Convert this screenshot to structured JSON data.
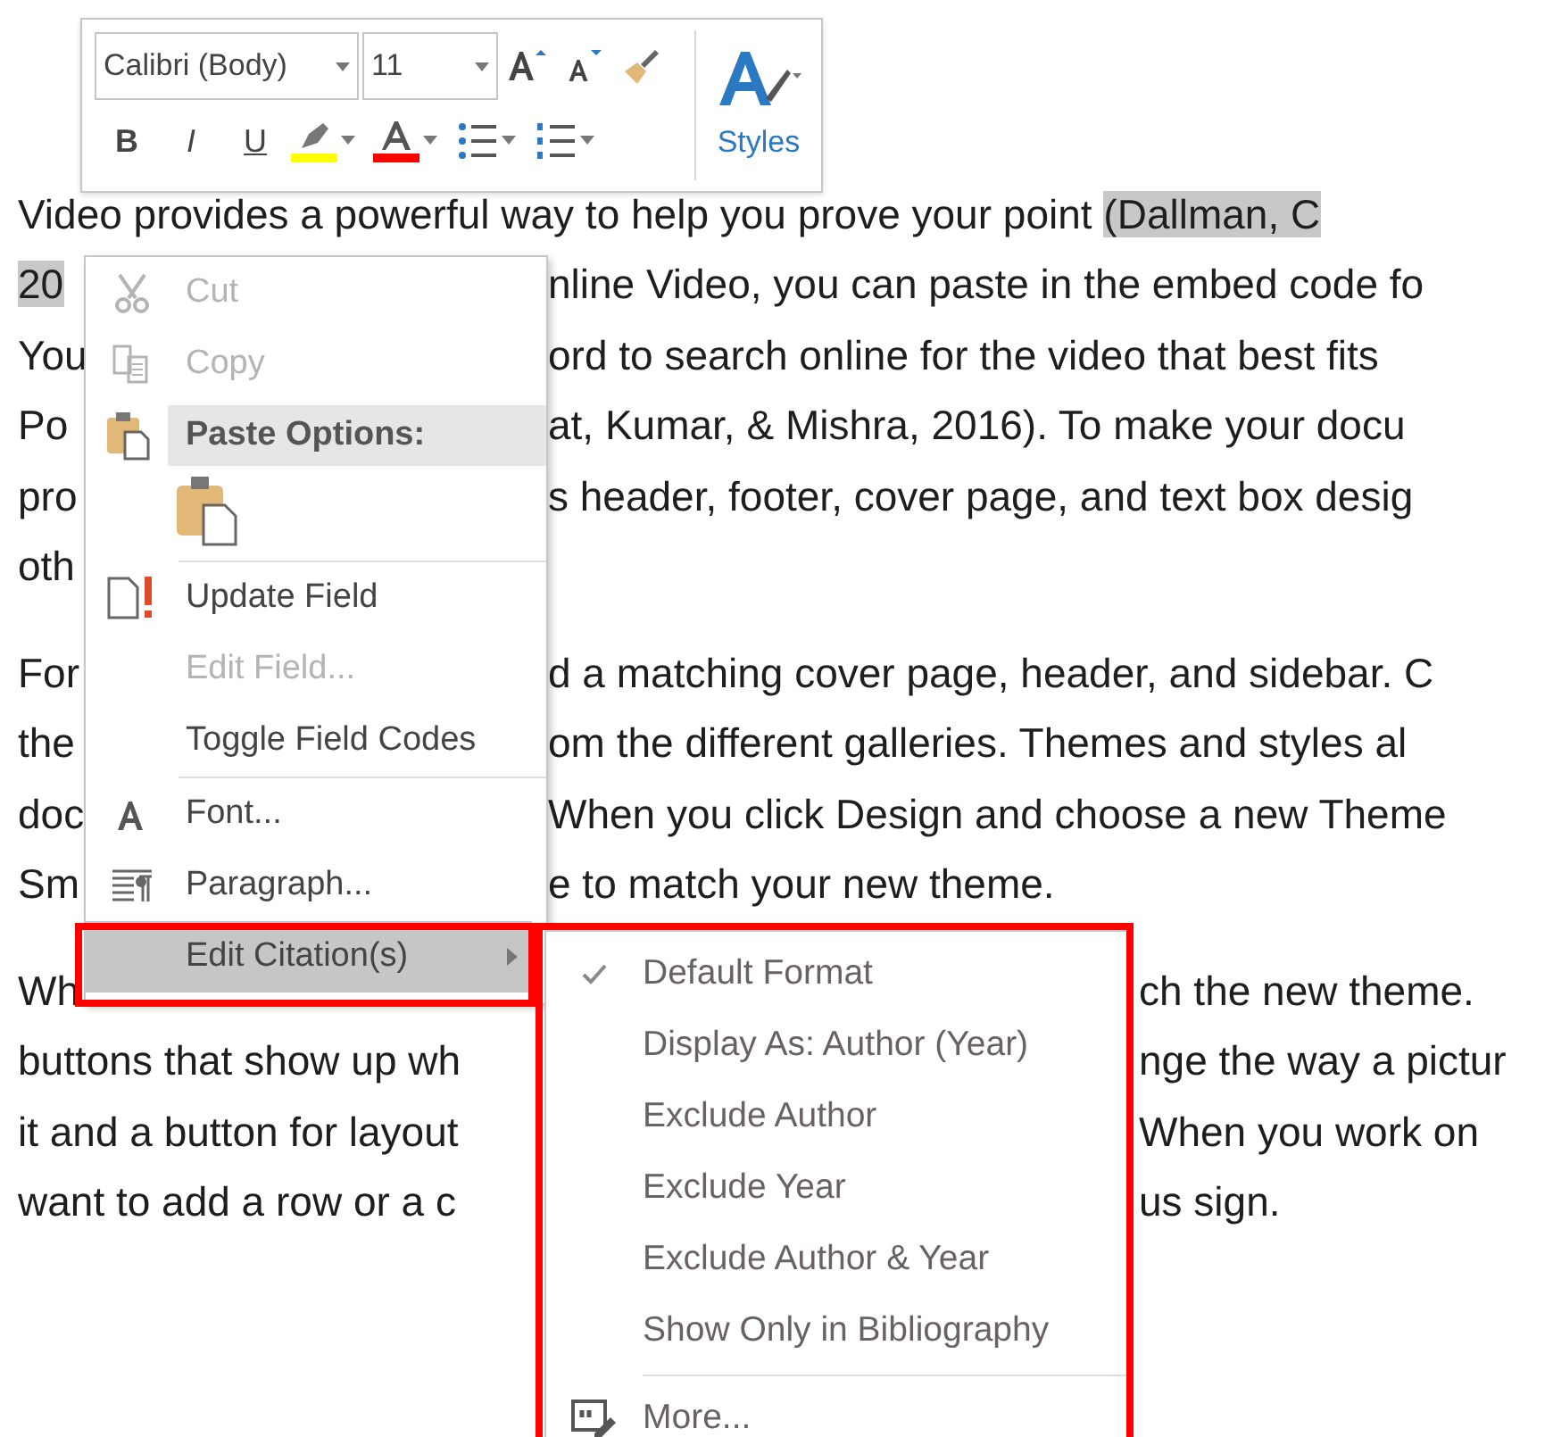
{
  "document": {
    "paragraphs": [
      {
        "lines": [
          {
            "left": "Video provides a powerful way to help you prove your point ",
            "left_selected": "(Dallman, C"
          },
          {
            "left_selected": "20",
            "right": "nline Video, you can paste in the embed code fo"
          },
          {
            "left": "You",
            "right": "ord to search online for the video that best fits"
          },
          {
            "left": "Po",
            "right": "at, Kumar, & Mishra, 2016). To make your docu"
          },
          {
            "left": "pro",
            "right": "s header, footer, cover page, and text box desig"
          },
          {
            "left": "oth"
          }
        ]
      },
      {
        "lines": [
          {
            "left": "For",
            "right": "d a matching cover page, header, and sidebar. C"
          },
          {
            "left": "the",
            "right": "om the different galleries. Themes and styles al"
          },
          {
            "left": "doc",
            "right": "When you click Design and choose a new Theme"
          },
          {
            "left": "Sm",
            "right": "e to match your new theme."
          }
        ]
      },
      {
        "lines": [
          {
            "left": "Wh",
            "right": "ch the new theme."
          },
          {
            "left": "buttons that show up wh",
            "right": "nge the way a pictur"
          },
          {
            "left": "it and a button for layout",
            "right": "When you work on"
          },
          {
            "left": "want to add a row or a c",
            "right": "us sign."
          }
        ]
      }
    ]
  },
  "mini_toolbar": {
    "font_name": "Calibri (Body)",
    "font_size": "11",
    "styles_label": "Styles",
    "format_buttons": [
      "B",
      "I",
      "U"
    ]
  },
  "context_menu": {
    "items": [
      {
        "kind": "cut",
        "label": "Cut",
        "disabled": true
      },
      {
        "kind": "copy",
        "label": "Copy",
        "disabled": true
      },
      {
        "kind": "header",
        "label": "Paste Options:"
      },
      {
        "kind": "paste-option"
      },
      {
        "kind": "separator"
      },
      {
        "kind": "update-field",
        "label": "Update Field",
        "disabled": false
      },
      {
        "kind": "plain",
        "label": "Edit Field...",
        "disabled": true
      },
      {
        "kind": "plain",
        "label": "Toggle Field Codes",
        "disabled": false
      },
      {
        "kind": "separator"
      },
      {
        "kind": "font",
        "label": "Font...",
        "disabled": false
      },
      {
        "kind": "paragraph",
        "label": "Paragraph...",
        "disabled": false
      },
      {
        "kind": "submenu",
        "label": "Edit Citation(s)",
        "disabled": false,
        "selected": true,
        "outlined": true
      }
    ]
  },
  "submenu": {
    "outlined": true,
    "items": [
      {
        "kind": "option",
        "label": "Default Format",
        "checked": true
      },
      {
        "kind": "option",
        "label": "Display As: Author (Year)",
        "checked": false
      },
      {
        "kind": "option",
        "label": "Exclude Author",
        "checked": false
      },
      {
        "kind": "option",
        "label": "Exclude Year",
        "checked": false
      },
      {
        "kind": "option",
        "label": "Exclude Author & Year",
        "checked": false
      },
      {
        "kind": "option",
        "label": "Show Only in Bibliography",
        "checked": false
      },
      {
        "kind": "separator"
      },
      {
        "kind": "more",
        "label": "More..."
      }
    ]
  }
}
